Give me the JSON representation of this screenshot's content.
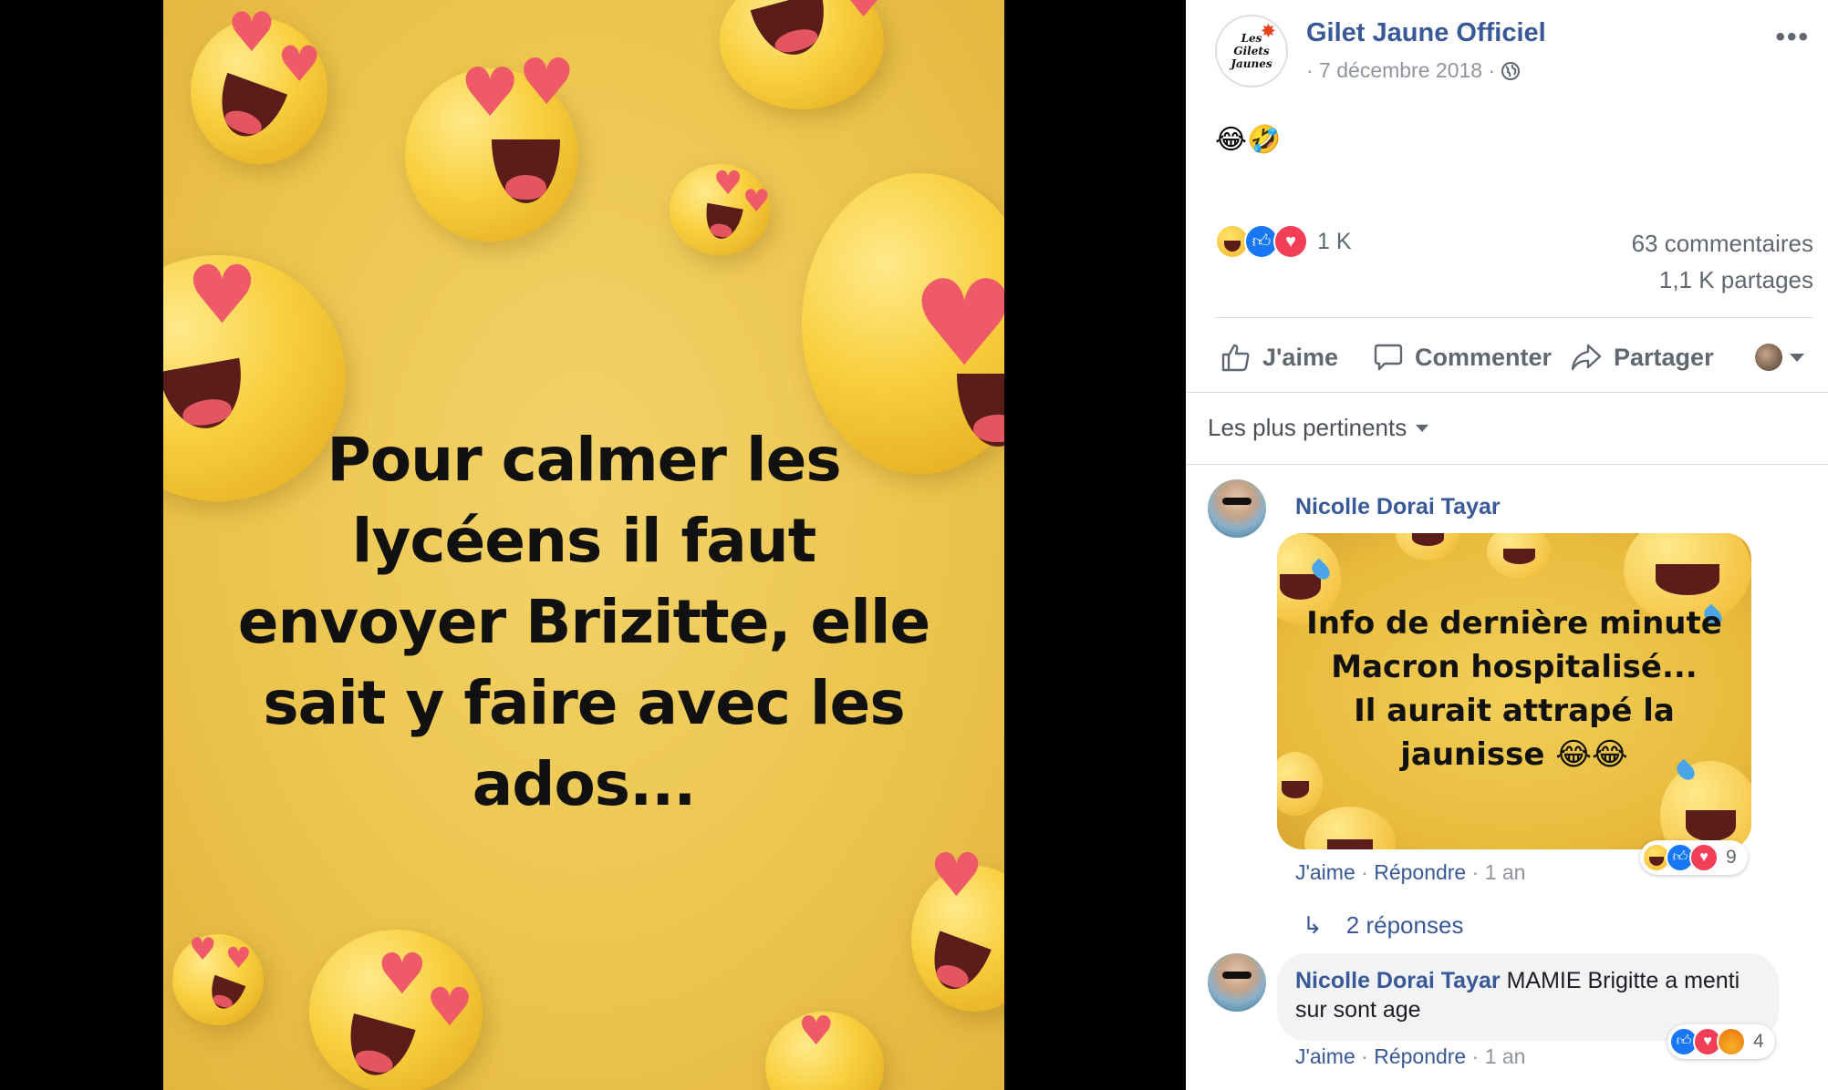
{
  "photo": {
    "caption_lines": [
      "Pour calmer les",
      "lycéens il faut",
      "envoyer Brizitte, elle",
      "sait y faire avec les",
      "ados..."
    ]
  },
  "post": {
    "page_name": "Gilet Jaune Officiel",
    "avatar_text": [
      "Les",
      "Gilets",
      "Jaunes"
    ],
    "date": "· 7 décembre 2018 ·",
    "text": "😂🤣",
    "reaction_count": "1 K",
    "comments_count": "63 commentaires",
    "shares_count": "1,1 K partages",
    "actions": {
      "like": "J'aime",
      "comment": "Commenter",
      "share": "Partager"
    },
    "icons": [
      "globe-icon",
      "more-icon",
      "like-icon",
      "comment-icon",
      "share-icon",
      "chevron-down-icon"
    ]
  },
  "comments": {
    "sort_label": "Les plus pertinents",
    "items": [
      {
        "author": "Nicolle Dorai Tayar",
        "image_text_lines": [
          "Info de dernière minute",
          "Macron hospitalisé...",
          "Il aurait attrapé la",
          "jaunisse 😂😂"
        ],
        "reaction_count": "9",
        "like": "J'aime",
        "reply": "Répondre",
        "time": "1 an"
      },
      {
        "author": "Nicolle Dorai Tayar",
        "text": "MAMIE Brigitte a menti sur sont age",
        "reaction_count": "4",
        "like": "J'aime",
        "reply": "Répondre",
        "time": "1 an"
      }
    ],
    "replies_link": "2 réponses"
  },
  "colors": {
    "link": "#385898",
    "muted": "#90949c",
    "accent": "#1877f2",
    "love": "#f33e58"
  }
}
